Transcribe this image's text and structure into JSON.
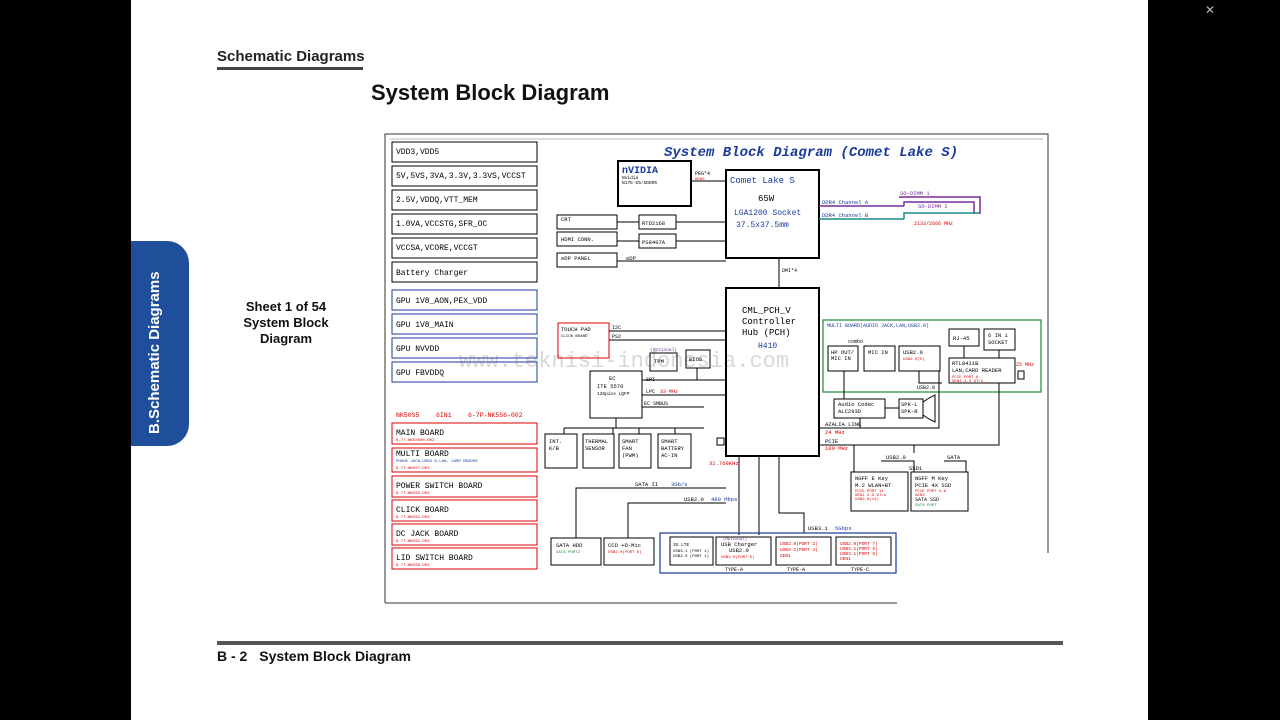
{
  "viewer": {
    "exit_icon": "exit-fullscreen-icon",
    "exit_glyph": "✕"
  },
  "page": {
    "section_header": "Schematic  Diagrams",
    "title": "System Block Diagram",
    "side_tab": "B.Schematic Diagrams",
    "sheet_info": [
      "Sheet 1 of 54",
      "System Block",
      "Diagram"
    ],
    "footer_number": "B - 2",
    "footer_title": "System Block Diagram"
  },
  "schematic": {
    "title": "System Block Diagram (Comet Lake S)",
    "watermark": "www.teknisi-indonesia.com",
    "power_rails": [
      "VDD3,VDD5",
      "5V,5VS,3VA,3.3V,3.3VS,VCCST",
      "2.5V,VDDQ,VTT_MEM",
      "1.0VA,VCCSTG,SFR_OC",
      "VCCSA,VCORE,VCCGT",
      "Battery Charger"
    ],
    "gpu_rails": [
      "GPU 1V8_AON,PEX_VDD",
      "GPU 1V8_MAIN",
      "GPU NVVDD",
      "GPU FBVDDQ"
    ],
    "board_info": {
      "model": "NK50S5",
      "type": "6IN1",
      "code": "6-7P-NK5S6-002"
    },
    "boards": [
      {
        "name": "MAIN BOARD",
        "sub": "6-77-NK50S00-D02"
      },
      {
        "name": "MULTI BOARD",
        "sub": "PHONE JACK,USB3.0,LAN, CARD READER",
        "sub2": "6-77-NK5S7-D02"
      },
      {
        "name": "POWER SWITCH BOARD",
        "sub": "6-77-NK5S5-D02"
      },
      {
        "name": "CLICK BOARD",
        "sub": "6-77-NK5S1-D02"
      },
      {
        "name": "DC JACK BOARD",
        "sub": "6-77-NK5SC-D02"
      },
      {
        "name": "LID SWITCH BOARD",
        "sub": "6-77-NK5S6-D02"
      }
    ],
    "gpu": {
      "name": "nVIDIA",
      "sub1": "Nvidia",
      "sub2": "N17E-G5/GDDR5",
      "peg": "PEG*4",
      "peg_sub": "GEN3"
    },
    "cpu": {
      "name": "Comet Lake S",
      "tdp": "65W",
      "socket": "LGA1200 Socket",
      "size": "37.5x37.5mm"
    },
    "memory": {
      "ch_a": "DDR4 Channel A",
      "ch_b": "DDR4 Channel B",
      "dimm1": "SO-DIMM 1",
      "dimm2": "SO-DIMM 2",
      "speed": "2133/2666 MHz"
    },
    "display": {
      "crt": "CRT",
      "rtd": "RTD2168",
      "hdmi": "HDMI CONN.",
      "ps": "PS8407A",
      "edp_panel": "eDP PANEL",
      "edp": "eDP"
    },
    "dmi": "DMI*4",
    "pch": {
      "l1": "CML_PCH_V",
      "l2": "Controller",
      "l3": "Hub (PCH)",
      "l4": "H410"
    },
    "touchpad": {
      "name": "TOUCH PAD",
      "sub": "CLICK BOARD",
      "i2c": "I2C",
      "ps2": "PS2"
    },
    "tpm": {
      "opt": "(Optional)",
      "name": "TPM",
      "bios": "BIOS"
    },
    "ec": {
      "name": "EC",
      "model": "ITE 5570",
      "pkg": "128pins LQFP",
      "spi": "SPI",
      "lpc": "LPC",
      "lpc_clk": "33 MHz",
      "smbus": "EC SMBUS"
    },
    "ec_devices": [
      {
        "l1": "INT.",
        "l2": "K/B",
        "l3": ""
      },
      {
        "l1": "THERMAL",
        "l2": "SENSOR",
        "l3": ""
      },
      {
        "l1": "SMART",
        "l2": "FAN",
        "l3": "(PWM)"
      },
      {
        "l1": "SMART",
        "l2": "BATTERY",
        "l3": "AC-IN"
      }
    ],
    "clock_32k": "32.768KHz",
    "multi_board": {
      "title": "MULTI BOARD(AUDIO JACK,LAN,USB2.0)",
      "combo": "combo",
      "hp1": "HP OUT/",
      "hp2": "MIC IN",
      "mic": "MIC IN",
      "usb": "USB2.0",
      "usb_sub": "USB2.0(5)",
      "rj45": "RJ-45",
      "sixin1_a": "6 IN 1",
      "sixin1_b": "SOCKET",
      "rtl1": "RTL8411B",
      "rtl2": "LAN,CARD READER",
      "rtl3": "PCIE PORT 8",
      "rtl4": "GEN1 2.5 GT/s",
      "clk25": "25 MHz",
      "usb_bottom": "USB2.0"
    },
    "audio": {
      "codec1": "Audio Codec",
      "codec2": "ALC293D",
      "spk1": "SPK-L",
      "spk2": "SPK-R",
      "azalia": "AZALIA LINK",
      "azalia_clk": "24 MHz"
    },
    "pcie": {
      "label": "PCIE",
      "clk": "100 MHz"
    },
    "m2": {
      "usb20": "USB2.0",
      "sata": "SATA",
      "ssd1": "SSD1",
      "e1": "NGFF E Key",
      "e2": "M.2 WLAN+BT",
      "e3": "PCIE PORT 11",
      "e4": "GEN1 2.5 GT/s",
      "e5": "USB2.0(14)",
      "m1": "NGFF M Key",
      "m2": "PCIE 4X SSD",
      "m3": "PCIE PORT 5-8",
      "m4": "GEN3",
      "m5": "SATA SSD",
      "m6": "SATA PORT"
    },
    "storage": {
      "sata2": "SATA II",
      "sata_speed": "3Gb/s",
      "usb20": "USB2.0",
      "usb20_speed": "480 Mbps",
      "hdd": "SATA HDD",
      "hdd_sub": "SATA PORT2",
      "ccd": "CCD +D-Mic",
      "ccd_sub": "USB2.0(PORT 8)",
      "usb31": "USB3.1",
      "usb31_speed": "5Gbps"
    },
    "usb_ports": [
      {
        "l1": "3G LTE",
        "l2": "USB3.1 (PORT 1)",
        "l3": "USB2.0 (PORT 1)"
      },
      {
        "opt": "(Optional)",
        "l1": "USB Charger",
        "l2": "USB2.0",
        "l3": "USB2.0(PORT 5)"
      },
      {
        "l1": "USB2.0(PORT 2)",
        "l2": "USB3.1(PORT 4)",
        "l3": "GEN1"
      },
      {
        "l1": "USB2.0(PORT 7)",
        "l2": "USB3.1(PORT 5)",
        "l3": "USB3.1(PORT 6)",
        "l4": "GEN1"
      }
    ],
    "usb_types": [
      "TYPE-A",
      "TYPE-A",
      "TYPE-C"
    ]
  }
}
